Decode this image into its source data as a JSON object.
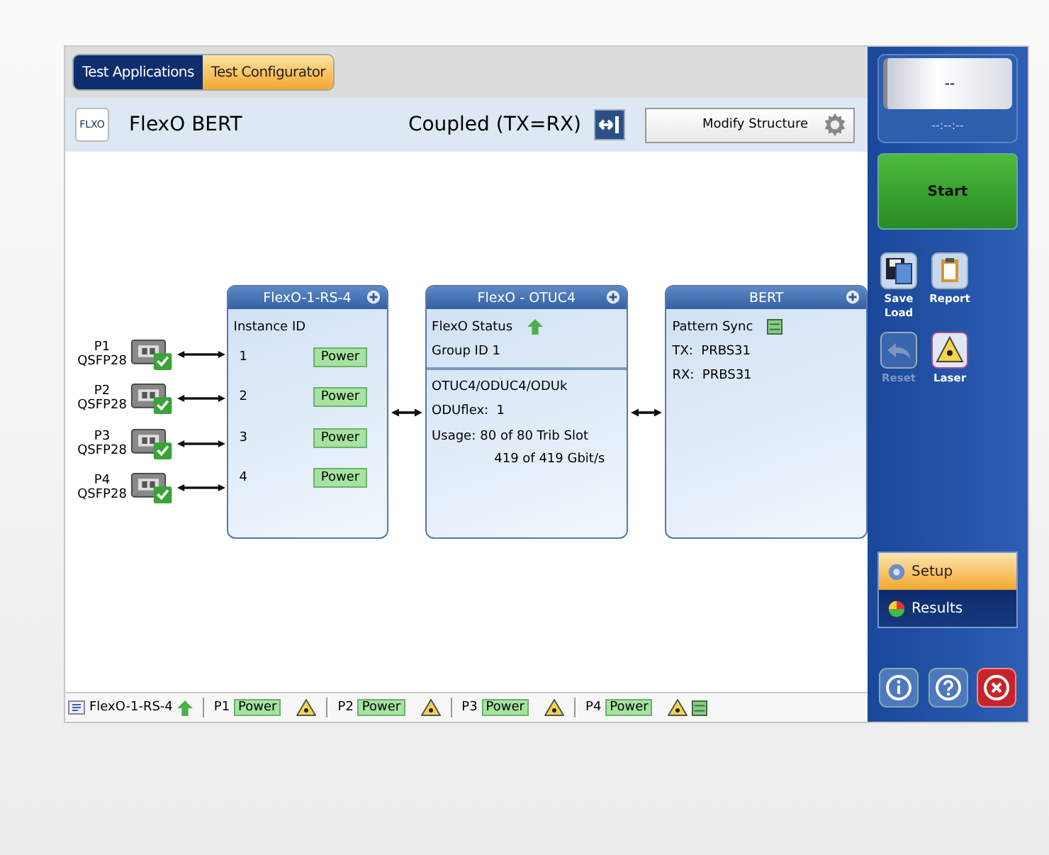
{
  "tabs": [
    {
      "label": "Test Applications",
      "selected": false
    },
    {
      "label": "Test Configurator",
      "selected": true
    }
  ],
  "header": {
    "logo": "FLXO",
    "title": "FlexO BERT",
    "coupling": "Coupled (TX=RX)",
    "modify_button": "Modify Structure"
  },
  "ports": [
    {
      "name": "P1",
      "type": "QSFP28",
      "checked": true
    },
    {
      "name": "P2",
      "type": "QSFP28",
      "checked": true
    },
    {
      "name": "P3",
      "type": "QSFP28",
      "checked": true
    },
    {
      "name": "P4",
      "type": "QSFP28",
      "checked": true
    }
  ],
  "rs_block": {
    "title": "FlexO-1-RS-4",
    "heading": "Instance ID",
    "instances": [
      {
        "id": "1",
        "status": "Power"
      },
      {
        "id": "2",
        "status": "Power"
      },
      {
        "id": "3",
        "status": "Power"
      },
      {
        "id": "4",
        "status": "Power"
      }
    ]
  },
  "otuc_block": {
    "title": "FlexO - OTUC4",
    "status_label": "FlexO Status",
    "group": "Group ID 1",
    "mapping": "OTUC4/ODUC4/ODUk",
    "oduflex": "ODUflex:  1",
    "usage_label": "Usage:",
    "usage_slots": "80 of 80 Trib Slot",
    "usage_rate": "419 of 419 Gbit/s"
  },
  "bert_block": {
    "title": "BERT",
    "sync_label": "Pattern Sync",
    "tx": "TX:  PRBS31",
    "rx": "RX:  PRBS31"
  },
  "side_panel": {
    "display": "--",
    "timer": "--:--:--",
    "start": "Start",
    "actions": [
      {
        "kind": "save",
        "lines": [
          "Save",
          "Load"
        ],
        "disabled": false
      },
      {
        "kind": "report",
        "lines": [
          "Report"
        ],
        "disabled": false
      },
      {
        "kind": "reset",
        "lines": [
          "Reset"
        ],
        "disabled": true
      },
      {
        "kind": "laser",
        "lines": [
          "Laser"
        ],
        "disabled": false
      }
    ],
    "nav": [
      {
        "kind": "setup",
        "label": "Setup",
        "selected": true
      },
      {
        "kind": "results",
        "label": "Results",
        "selected": false
      }
    ]
  },
  "status_bar": {
    "module": "FlexO-1-RS-4",
    "ports": [
      {
        "name": "P1",
        "status": "Power"
      },
      {
        "name": "P2",
        "status": "Power"
      },
      {
        "name": "P3",
        "status": "Power"
      },
      {
        "name": "P4",
        "status": "Power"
      }
    ]
  }
}
